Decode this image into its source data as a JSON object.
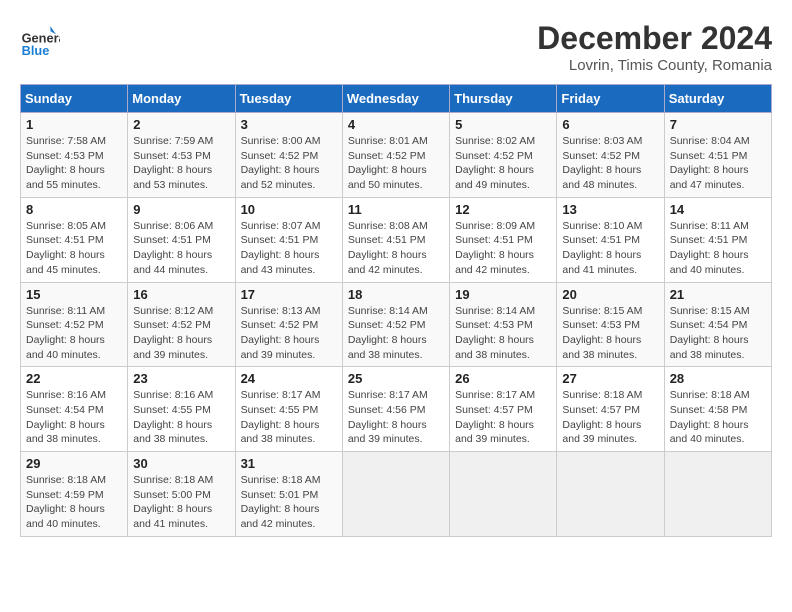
{
  "header": {
    "logo_line1": "General",
    "logo_line2": "Blue",
    "month_title": "December 2024",
    "subtitle": "Lovrin, Timis County, Romania"
  },
  "days_of_week": [
    "Sunday",
    "Monday",
    "Tuesday",
    "Wednesday",
    "Thursday",
    "Friday",
    "Saturday"
  ],
  "weeks": [
    [
      {
        "day": "1",
        "info": "Sunrise: 7:58 AM\nSunset: 4:53 PM\nDaylight: 8 hours\nand 55 minutes."
      },
      {
        "day": "2",
        "info": "Sunrise: 7:59 AM\nSunset: 4:53 PM\nDaylight: 8 hours\nand 53 minutes."
      },
      {
        "day": "3",
        "info": "Sunrise: 8:00 AM\nSunset: 4:52 PM\nDaylight: 8 hours\nand 52 minutes."
      },
      {
        "day": "4",
        "info": "Sunrise: 8:01 AM\nSunset: 4:52 PM\nDaylight: 8 hours\nand 50 minutes."
      },
      {
        "day": "5",
        "info": "Sunrise: 8:02 AM\nSunset: 4:52 PM\nDaylight: 8 hours\nand 49 minutes."
      },
      {
        "day": "6",
        "info": "Sunrise: 8:03 AM\nSunset: 4:52 PM\nDaylight: 8 hours\nand 48 minutes."
      },
      {
        "day": "7",
        "info": "Sunrise: 8:04 AM\nSunset: 4:51 PM\nDaylight: 8 hours\nand 47 minutes."
      }
    ],
    [
      {
        "day": "8",
        "info": "Sunrise: 8:05 AM\nSunset: 4:51 PM\nDaylight: 8 hours\nand 45 minutes."
      },
      {
        "day": "9",
        "info": "Sunrise: 8:06 AM\nSunset: 4:51 PM\nDaylight: 8 hours\nand 44 minutes."
      },
      {
        "day": "10",
        "info": "Sunrise: 8:07 AM\nSunset: 4:51 PM\nDaylight: 8 hours\nand 43 minutes."
      },
      {
        "day": "11",
        "info": "Sunrise: 8:08 AM\nSunset: 4:51 PM\nDaylight: 8 hours\nand 42 minutes."
      },
      {
        "day": "12",
        "info": "Sunrise: 8:09 AM\nSunset: 4:51 PM\nDaylight: 8 hours\nand 42 minutes."
      },
      {
        "day": "13",
        "info": "Sunrise: 8:10 AM\nSunset: 4:51 PM\nDaylight: 8 hours\nand 41 minutes."
      },
      {
        "day": "14",
        "info": "Sunrise: 8:11 AM\nSunset: 4:51 PM\nDaylight: 8 hours\nand 40 minutes."
      }
    ],
    [
      {
        "day": "15",
        "info": "Sunrise: 8:11 AM\nSunset: 4:52 PM\nDaylight: 8 hours\nand 40 minutes."
      },
      {
        "day": "16",
        "info": "Sunrise: 8:12 AM\nSunset: 4:52 PM\nDaylight: 8 hours\nand 39 minutes."
      },
      {
        "day": "17",
        "info": "Sunrise: 8:13 AM\nSunset: 4:52 PM\nDaylight: 8 hours\nand 39 minutes."
      },
      {
        "day": "18",
        "info": "Sunrise: 8:14 AM\nSunset: 4:52 PM\nDaylight: 8 hours\nand 38 minutes."
      },
      {
        "day": "19",
        "info": "Sunrise: 8:14 AM\nSunset: 4:53 PM\nDaylight: 8 hours\nand 38 minutes."
      },
      {
        "day": "20",
        "info": "Sunrise: 8:15 AM\nSunset: 4:53 PM\nDaylight: 8 hours\nand 38 minutes."
      },
      {
        "day": "21",
        "info": "Sunrise: 8:15 AM\nSunset: 4:54 PM\nDaylight: 8 hours\nand 38 minutes."
      }
    ],
    [
      {
        "day": "22",
        "info": "Sunrise: 8:16 AM\nSunset: 4:54 PM\nDaylight: 8 hours\nand 38 minutes."
      },
      {
        "day": "23",
        "info": "Sunrise: 8:16 AM\nSunset: 4:55 PM\nDaylight: 8 hours\nand 38 minutes."
      },
      {
        "day": "24",
        "info": "Sunrise: 8:17 AM\nSunset: 4:55 PM\nDaylight: 8 hours\nand 38 minutes."
      },
      {
        "day": "25",
        "info": "Sunrise: 8:17 AM\nSunset: 4:56 PM\nDaylight: 8 hours\nand 39 minutes."
      },
      {
        "day": "26",
        "info": "Sunrise: 8:17 AM\nSunset: 4:57 PM\nDaylight: 8 hours\nand 39 minutes."
      },
      {
        "day": "27",
        "info": "Sunrise: 8:18 AM\nSunset: 4:57 PM\nDaylight: 8 hours\nand 39 minutes."
      },
      {
        "day": "28",
        "info": "Sunrise: 8:18 AM\nSunset: 4:58 PM\nDaylight: 8 hours\nand 40 minutes."
      }
    ],
    [
      {
        "day": "29",
        "info": "Sunrise: 8:18 AM\nSunset: 4:59 PM\nDaylight: 8 hours\nand 40 minutes."
      },
      {
        "day": "30",
        "info": "Sunrise: 8:18 AM\nSunset: 5:00 PM\nDaylight: 8 hours\nand 41 minutes."
      },
      {
        "day": "31",
        "info": "Sunrise: 8:18 AM\nSunset: 5:01 PM\nDaylight: 8 hours\nand 42 minutes."
      },
      {
        "day": "",
        "info": ""
      },
      {
        "day": "",
        "info": ""
      },
      {
        "day": "",
        "info": ""
      },
      {
        "day": "",
        "info": ""
      }
    ]
  ]
}
